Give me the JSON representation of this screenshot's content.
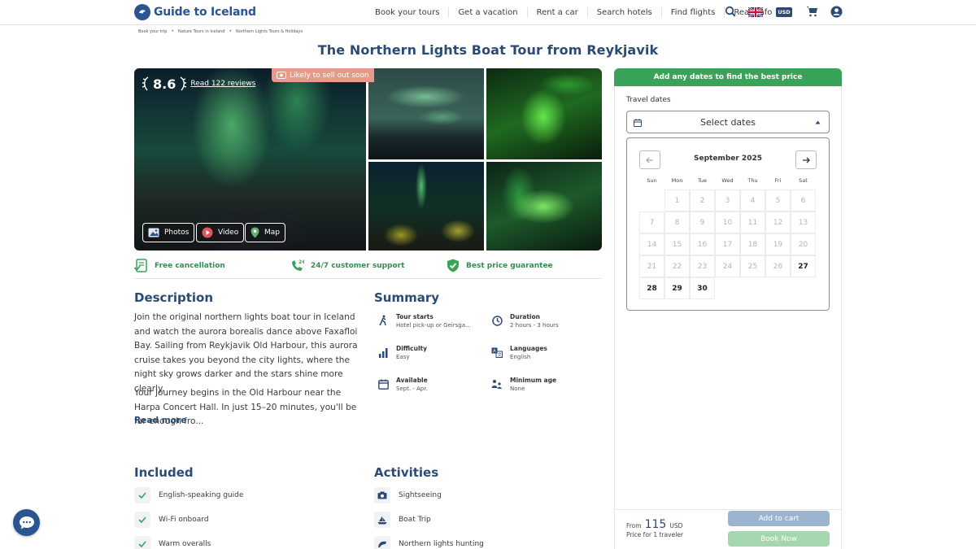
{
  "header": {
    "logo_text": "Guide to Iceland",
    "nav": [
      "Book your tours",
      "Get a vacation",
      "Rent a car",
      "Search hotels",
      "Find flights",
      "Read info"
    ],
    "currency": "USD"
  },
  "breadcrumb": [
    "Book your trip",
    "Nature Tours in Iceland",
    "Northern Lights Tours & Holidays"
  ],
  "title": "The Northern Lights Boat Tour from Reykjavik",
  "gallery": {
    "rating": "8.6",
    "reviews_link": "Read 122 reviews",
    "sellout_badge": "Likely to sell out soon",
    "buttons": {
      "photos": "Photos",
      "video": "Video",
      "map": "Map"
    }
  },
  "features": [
    "Free cancellation",
    "24/7 customer support",
    "Best price guarantee"
  ],
  "description": {
    "heading": "Description",
    "para1": "Join the original northern lights boat tour in Iceland and watch the aurora borealis dance above Faxafloi Bay. Sailing from Reykjavik Old Harbour, this aurora cruise takes you beyond the city lights, where the night sky grows darker and the stars shine more clearly.",
    "para2": "Your journey begins in the Old Harbour near the Harpa Concert Hall. In just 15–20 minutes, you'll be far enough fro...",
    "read_more": "Read more"
  },
  "summary": {
    "heading": "Summary",
    "items": [
      {
        "title": "Tour starts",
        "value": "Hotel pick-up or Geirsga..."
      },
      {
        "title": "Duration",
        "value": "2 hours - 3 hours"
      },
      {
        "title": "Difficulty",
        "value": "Easy"
      },
      {
        "title": "Languages",
        "value": "English"
      },
      {
        "title": "Available",
        "value": "Sept. - Apr."
      },
      {
        "title": "Minimum age",
        "value": "None"
      }
    ]
  },
  "included": {
    "heading": "Included",
    "items": [
      "English-speaking guide",
      "Wi-Fi onboard",
      "Warm overalls"
    ]
  },
  "activities": {
    "heading": "Activities",
    "items": [
      "Sightseeing",
      "Boat Trip",
      "Northern lights hunting"
    ]
  },
  "booking": {
    "header": "Add any dates to find the best price",
    "travel_dates_label": "Travel dates",
    "select_dates": "Select dates",
    "calendar": {
      "month": "September 2025",
      "weekdays": [
        "Sun",
        "Mon",
        "Tue",
        "Wed",
        "Thu",
        "Fri",
        "Sat"
      ],
      "days": [
        "1",
        "2",
        "3",
        "4",
        "5",
        "6",
        "7",
        "8",
        "9",
        "10",
        "11",
        "12",
        "13",
        "14",
        "15",
        "16",
        "17",
        "18",
        "19",
        "20",
        "21",
        "22",
        "23",
        "24",
        "25",
        "26",
        "27",
        "28",
        "29",
        "30"
      ],
      "available_days": [
        "27",
        "28",
        "29",
        "30"
      ]
    },
    "from_label": "From",
    "price": "115",
    "currency": "USD",
    "price_note": "Price for 1 traveler",
    "add_to_cart": "Add to cart",
    "book_now": "Book Now"
  },
  "colors": {
    "brand_blue": "#2b4a74",
    "green": "#3aa35a",
    "sellout": "#e79a8a"
  }
}
